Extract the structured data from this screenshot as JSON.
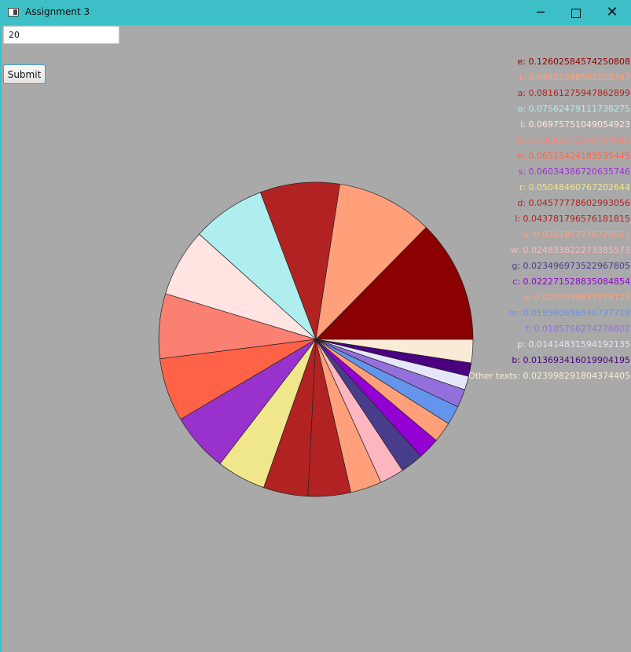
{
  "window": {
    "title": "Assignment 3"
  },
  "controls": {
    "count_value": "20",
    "submit_label": "Submit"
  },
  "chart_data": {
    "type": "pie",
    "slices": [
      {
        "label": "e",
        "value": 0.12602584574250808,
        "color": "#8b0000",
        "text": "e: 0.12602584574250808"
      },
      {
        "label": "t",
        "value": 0.09922388503100747,
        "color": "#ffa07a",
        "text": "t: 0.09922388503100747"
      },
      {
        "label": "a",
        "value": 0.08161275947862899,
        "color": "#b22222",
        "text": "a: 0.08161275947862899"
      },
      {
        "label": "o",
        "value": 0.07562479111738275,
        "color": "#afeeee",
        "text": "o: 0.07562479111738275"
      },
      {
        "label": "i",
        "value": 0.06975751049054923,
        "color": "#ffe4e1",
        "text": "i: 0.06975751049054923"
      },
      {
        "label": "h",
        "value": 0.0666,
        "color": "#fa8072",
        "text": "h: 0.06663773640734098"
      },
      {
        "label": "n",
        "value": 0.06513424189535445,
        "color": "#ff6347",
        "text": "n: 0.06513424189535445"
      },
      {
        "label": "s",
        "value": 0.06034386720635746,
        "color": "#9932cc",
        "text": "s: 0.06034386720635746"
      },
      {
        "label": "r",
        "value": 0.05048460767202644,
        "color": "#f0e68c",
        "text": "r: 0.05048460767202644"
      },
      {
        "label": "d",
        "value": 0.04577778602993056,
        "color": "#b22222",
        "text": "d: 0.04577778602993056"
      },
      {
        "label": "l",
        "value": 0.043781796576181815,
        "color": "#b22222",
        "text": "l: 0.043781796576181815"
      },
      {
        "label": "u",
        "value": 0.0321957740725611,
        "color": "#ffa07a",
        "text": "u: 0.0321957740725611"
      },
      {
        "label": "w",
        "value": 0.024833822273385573,
        "color": "#ffb6c1",
        "text": "w: 0.024833822273385573"
      },
      {
        "label": "g",
        "value": 0.023496973522967805,
        "color": "#483d8b",
        "text": "g: 0.023496973522967805"
      },
      {
        "label": "c",
        "value": 0.022271528835084854,
        "color": "#9400d3",
        "text": "c: 0.022271528835084854"
      },
      {
        "label": "y",
        "value": 0.0209996637878123,
        "color": "#ffa07a",
        "text": "y: 0.0209996637878123"
      },
      {
        "label": "m",
        "value": 0.019560696646737718,
        "color": "#6495ed",
        "text": "m: 0.019560696646737718"
      },
      {
        "label": "f",
        "value": 0.0185766274276802,
        "color": "#9370db",
        "text": "f: 0.0185766274276802"
      },
      {
        "label": "p",
        "value": 0.01414831594192135,
        "color": "#e6e6fa",
        "text": "p: 0.01414831594192135"
      },
      {
        "label": "b",
        "value": 0.013693416019904195,
        "color": "#4b0082",
        "text": "b: 0.013693416019904195"
      },
      {
        "label": "Other texts",
        "value": 0.023998291804374405,
        "color": "#faebd7",
        "text": "Other texts: 0.023998291804374405"
      }
    ]
  }
}
